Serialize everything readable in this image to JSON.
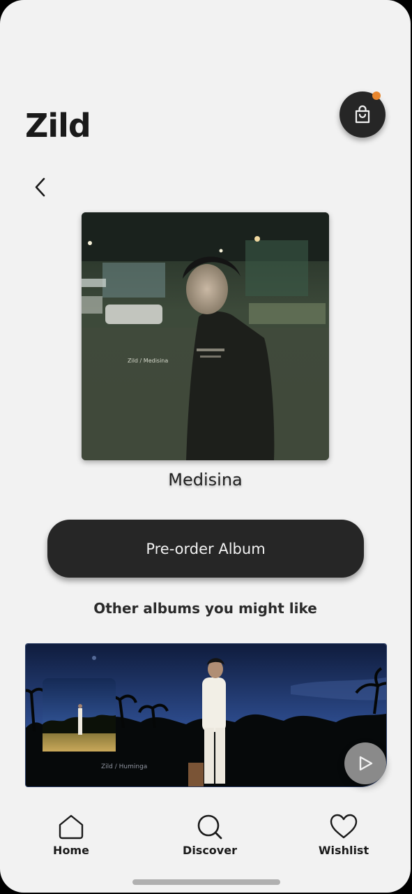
{
  "header": {
    "artist_name": "Zild",
    "cart_icon": "shopping-bag-icon",
    "cart_badge_color": "#e8862e"
  },
  "navigation": {
    "back_icon": "chevron-left-icon"
  },
  "album": {
    "cover_caption": "Zild / Medisina",
    "title": "Medisina"
  },
  "actions": {
    "preorder_label": "Pre-order Album"
  },
  "recommendations": {
    "heading": "Other albums you might like",
    "items": [
      {
        "cover_caption": "Zild / Huminga",
        "play_icon": "play-icon"
      }
    ]
  },
  "bottom_nav": {
    "items": [
      {
        "label": "Home",
        "icon": "home-icon"
      },
      {
        "label": "Discover",
        "icon": "search-icon"
      },
      {
        "label": "Wishlist",
        "icon": "heart-icon"
      }
    ]
  },
  "colors": {
    "background": "#f2f2f2",
    "primary_dark": "#262626",
    "accent": "#e8862e"
  }
}
